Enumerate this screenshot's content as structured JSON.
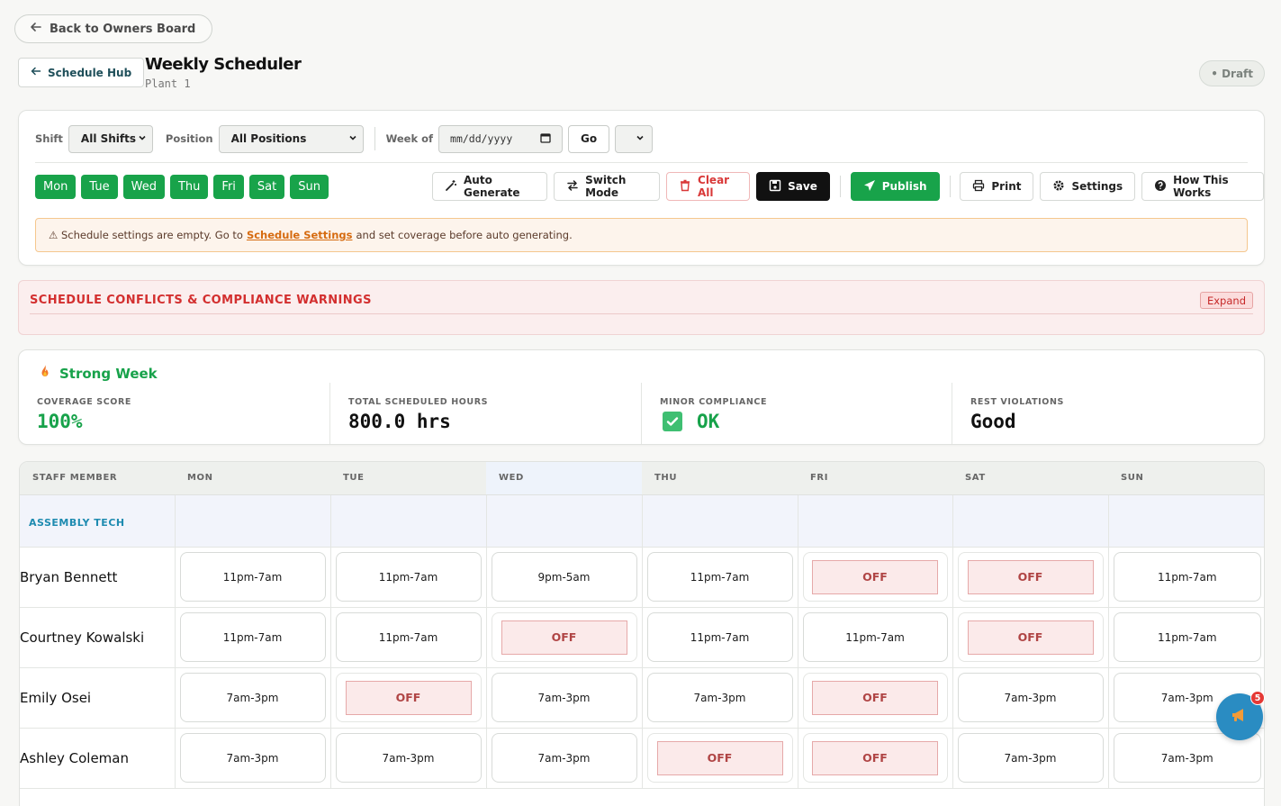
{
  "nav": {
    "back_owners_label": "Back to Owners Board",
    "schedule_hub_label": "Schedule Hub"
  },
  "header": {
    "title": "Weekly Scheduler",
    "subtitle": "Plant 1",
    "status_badge": "• Draft"
  },
  "filters": {
    "shift_label": "Shift",
    "shift_value": "All Shifts",
    "position_label": "Position",
    "position_value": "All Positions",
    "week_label": "Week of",
    "week_placeholder": "mm/dd/yyyy",
    "go_label": "Go"
  },
  "days": [
    "Mon",
    "Tue",
    "Wed",
    "Thu",
    "Fri",
    "Sat",
    "Sun"
  ],
  "actions": {
    "auto_generate": "Auto Generate",
    "switch_mode": "Switch Mode",
    "clear_all": "Clear All",
    "save": "Save",
    "publish": "Publish",
    "print": "Print",
    "settings": "Settings",
    "how_it_works": "How This Works"
  },
  "alert": {
    "prefix": "⚠ Schedule settings are empty. Go to",
    "link": "Schedule Settings",
    "suffix": "and set coverage before auto generating."
  },
  "conflicts": {
    "title": "SCHEDULE CONFLICTS & COMPLIANCE WARNINGS",
    "expand_label": "Expand"
  },
  "stats": {
    "headline": "Strong Week",
    "coverage_label": "COVERAGE SCORE",
    "coverage_value": "100%",
    "hours_label": "TOTAL SCHEDULED HOURS",
    "hours_value": "800.0 hrs",
    "minor_label": "MINOR COMPLIANCE",
    "minor_value": "OK",
    "rest_label": "REST VIOLATIONS",
    "rest_value": "Good"
  },
  "grid": {
    "columns": [
      "STAFF MEMBER",
      "MON",
      "TUE",
      "WED",
      "THU",
      "FRI",
      "SAT",
      "SUN"
    ],
    "group": "ASSEMBLY TECH",
    "rows": [
      {
        "name": "Bryan Bennett",
        "shifts": [
          "11pm-7am",
          "11pm-7am",
          "9pm-5am",
          "11pm-7am",
          "OFF",
          "OFF",
          "11pm-7am"
        ]
      },
      {
        "name": "Courtney Kowalski",
        "shifts": [
          "11pm-7am",
          "11pm-7am",
          "OFF",
          "11pm-7am",
          "11pm-7am",
          "OFF",
          "11pm-7am"
        ]
      },
      {
        "name": "Emily Osei",
        "shifts": [
          "7am-3pm",
          "OFF",
          "7am-3pm",
          "7am-3pm",
          "OFF",
          "7am-3pm",
          "7am-3pm"
        ]
      },
      {
        "name": "Ashley Coleman",
        "shifts": [
          "7am-3pm",
          "7am-3pm",
          "7am-3pm",
          "OFF",
          "OFF",
          "7am-3pm",
          "7am-3pm"
        ]
      }
    ]
  },
  "notifications": {
    "count": "5"
  },
  "colors": {
    "accent_green": "#18a34a",
    "danger_red": "#d32f2f",
    "fab_blue": "#2a8cc2"
  }
}
